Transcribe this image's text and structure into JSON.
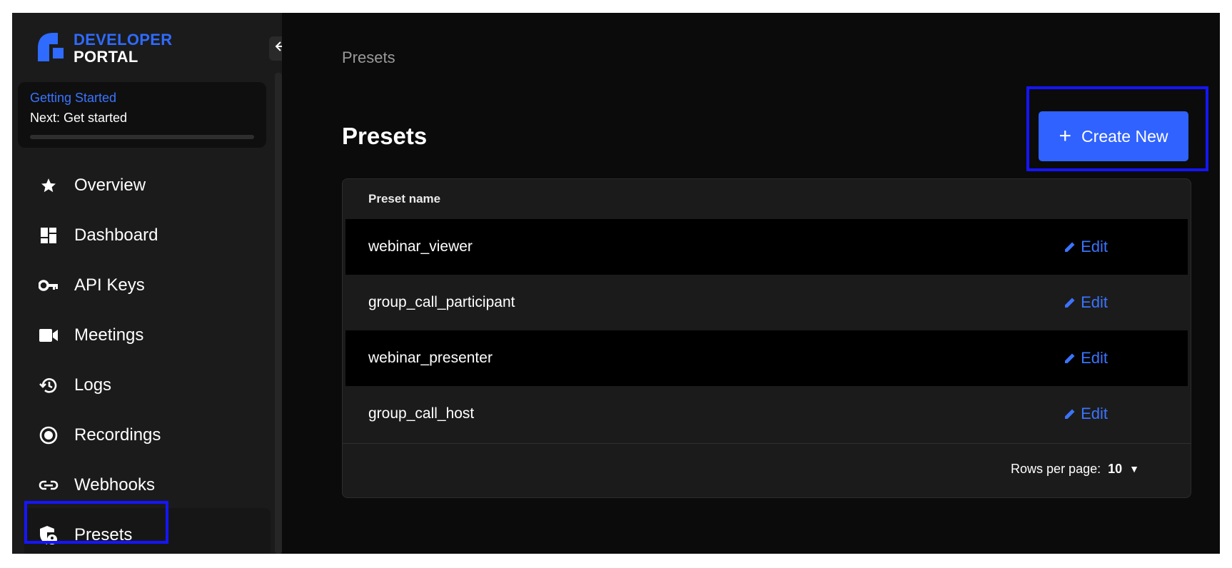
{
  "sidebar": {
    "logo": {
      "line1": "DEVELOPER",
      "line2": "PORTAL",
      "colors": {
        "mark": "#2f6bff",
        "line1": "#2f6bff",
        "line2": "#ffffff"
      }
    },
    "collapse_icon": "arrow-left-icon",
    "getting_started": {
      "title": "Getting Started",
      "next": "Next: Get started",
      "progress": 0
    },
    "items": [
      {
        "label": "Overview",
        "icon": "star-icon"
      },
      {
        "label": "Dashboard",
        "icon": "dashboard-icon"
      },
      {
        "label": "API Keys",
        "icon": "key-icon"
      },
      {
        "label": "Meetings",
        "icon": "video-icon"
      },
      {
        "label": "Logs",
        "icon": "history-icon"
      },
      {
        "label": "Recordings",
        "icon": "record-icon"
      },
      {
        "label": "Webhooks",
        "icon": "link-icon"
      },
      {
        "label": "Presets",
        "icon": "shield-user-icon",
        "active": true
      }
    ]
  },
  "main": {
    "breadcrumb": "Presets",
    "title": "Presets",
    "create_button": {
      "label": "Create New",
      "icon": "plus-icon",
      "color": "#2f62ff"
    },
    "table": {
      "header": "Preset name",
      "rows": [
        {
          "name": "webinar_viewer",
          "action": "Edit"
        },
        {
          "name": "group_call_participant",
          "action": "Edit"
        },
        {
          "name": "webinar_presenter",
          "action": "Edit"
        },
        {
          "name": "group_call_host",
          "action": "Edit"
        }
      ],
      "footer": {
        "rows_per_page_label": "Rows per page:",
        "rows_per_page_value": "10"
      }
    }
  },
  "highlight_color": "#1515ff"
}
